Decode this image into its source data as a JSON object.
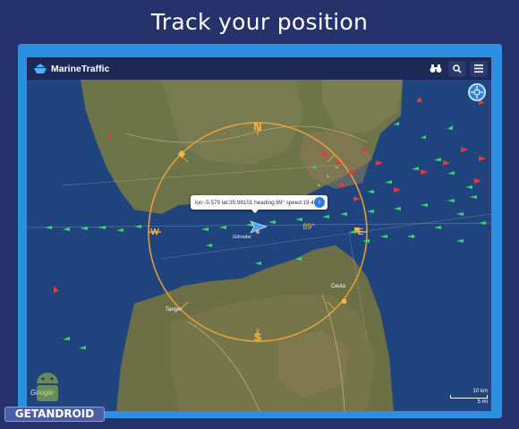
{
  "headline": "Track your position",
  "app": {
    "name": "MarineTraffic",
    "toolbar_icons": [
      "binoculars-icon",
      "search-icon",
      "menu-icon"
    ]
  },
  "map": {
    "compass": {
      "north": "N",
      "south": "S",
      "east": "E",
      "west": "W",
      "heading_readout": "89°"
    },
    "place_labels": {
      "ceuta": "Ceuta",
      "tangier": "Tanger",
      "gibraltar": "Gibraltar"
    },
    "position_tooltip": "lon:-5.579 lat:35.98101 heading:89° speed:19.4 kn",
    "scale": {
      "km": "10 km",
      "mi": "5 mi"
    },
    "attribution": "Google",
    "colors": {
      "sea": "#1f3f78",
      "land": "#6f7450",
      "ring": "#e8a33a",
      "cargo": "#3bd66b",
      "tanker": "#e23b3b",
      "own_vessel": "#4aa6ff"
    }
  },
  "watermark": "GETANDROID"
}
